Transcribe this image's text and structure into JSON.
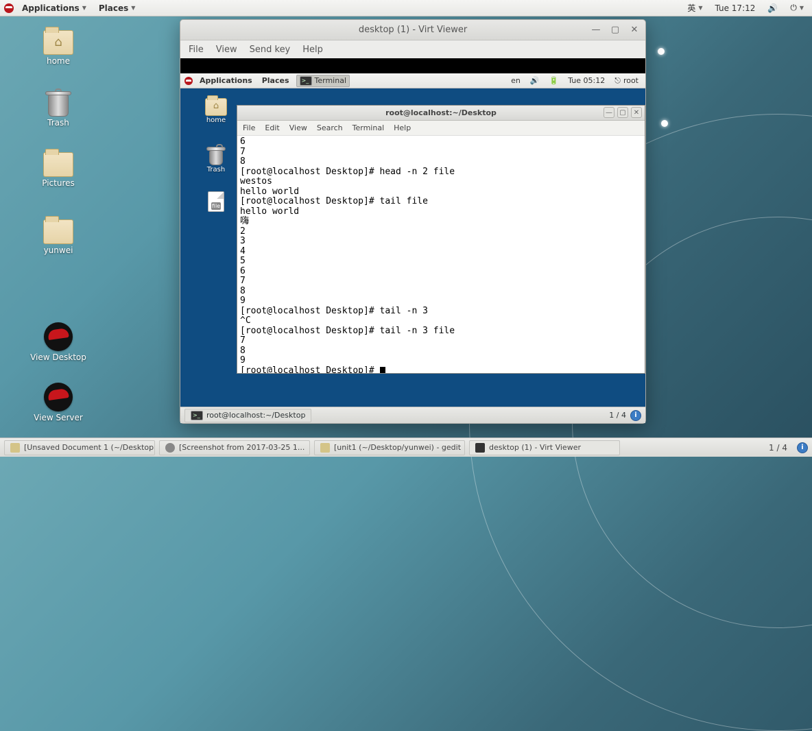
{
  "outer_panel": {
    "applications": "Applications",
    "places": "Places",
    "lang": "英",
    "clock": "Tue 17:12"
  },
  "desktop_icons": {
    "home": "home",
    "trash": "Trash",
    "pictures": "Pictures",
    "yunwei": "yunwei",
    "view_desktop": "View Desktop",
    "view_server": "View Server"
  },
  "virt_window": {
    "title": "desktop (1) - Virt Viewer",
    "menu": {
      "file": "File",
      "view": "View",
      "sendkey": "Send key",
      "help": "Help"
    }
  },
  "inner_panel": {
    "applications": "Applications",
    "places": "Places",
    "terminal": "Terminal",
    "lang": "en",
    "clock": "Tue 05:12",
    "user": "root"
  },
  "inner_icons": {
    "home": "home",
    "trash": "Trash",
    "file": "file"
  },
  "terminal": {
    "title": "root@localhost:~/Desktop",
    "menu": {
      "file": "File",
      "edit": "Edit",
      "view": "View",
      "search": "Search",
      "terminal": "Terminal",
      "help": "Help"
    },
    "lines": [
      "6",
      "7",
      "8",
      "[root@localhost Desktop]# head -n 2 file",
      "westos",
      "hello world",
      "[root@localhost Desktop]# tail file",
      "hello world",
      "嗨",
      "2",
      "3",
      "4",
      "5",
      "6",
      "7",
      "8",
      "9",
      "[root@localhost Desktop]# tail -n 3",
      "^C",
      "[root@localhost Desktop]# tail -n 3 file",
      "7",
      "8",
      "9",
      "[root@localhost Desktop]# "
    ]
  },
  "inner_bottom": {
    "task1": "root@localhost:~/Desktop",
    "workspace": "1 / 4"
  },
  "outer_bottom": {
    "t1": "[Unsaved Document 1 (~/Desktop...",
    "t2": "[Screenshot from 2017-03-25 1...",
    "t3": "[unit1 (~/Desktop/yunwei) - gedit",
    "t4": "desktop (1) - Virt Viewer",
    "workspace": "1 / 4"
  }
}
